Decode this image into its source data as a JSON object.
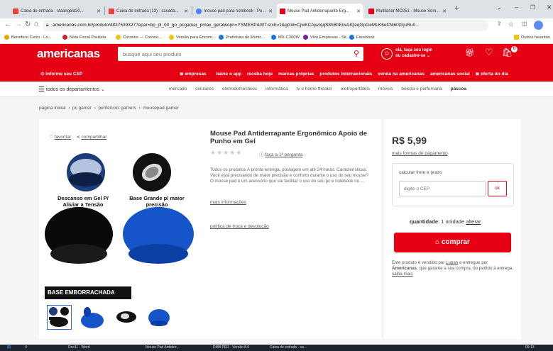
{
  "browser": {
    "tabs": [
      {
        "label": "Caixa de entrada - staangela20...",
        "color": "#ea4335"
      },
      {
        "label": "Caixa de entrada (13) - casada...",
        "color": "#ea4335"
      },
      {
        "label": "mouse pad para notebook - Pe...",
        "color": "#4285f4"
      },
      {
        "label": "Mouse Pad Antiderrapante Erg...",
        "color": "#e60014"
      },
      {
        "label": "Multilaser MO251 - Mouse Sem...",
        "color": "#e60014"
      }
    ],
    "new_tab": "+",
    "url": "americanas.com.br/produto/4837539327?epar=bp_pl_00_go_pcgamer_pmax_geral&opn=YSMESP&WT.srch=1&gclid=CjwKCAjwrqqS8hBhEiwAIQeqGpGeMLK6eCM6l3GjuRu0...",
    "bookmarks": [
      {
        "label": "Benefício Certo - Lo...",
        "color": "#f4a000"
      },
      {
        "label": "Nota Fiscal Paulista",
        "color": "#c62828"
      },
      {
        "label": "Correios — Correio...",
        "color": "#f4c20d"
      },
      {
        "label": "Versão para Encom...",
        "color": "#f4c20d"
      },
      {
        "label": "Prefeitura do Munic...",
        "color": "#1a73e8"
      },
      {
        "label": "MX-C300W",
        "color": "#1a73e8"
      },
      {
        "label": "Vivo Empresas - Sit...",
        "color": "#7b1fa2"
      },
      {
        "label": "Facebook",
        "color": "#1877f2"
      }
    ],
    "other_bookmarks": "Outros favoritos"
  },
  "header": {
    "logo": "americanas",
    "search_placeholder": "busque aqui seu produto",
    "login_line1": "olá, faça seu login",
    "login_line2": "ou cadastre-se",
    "cart_count": "0",
    "cep": "informe seu CEP",
    "links": [
      "empresas",
      "baixe o app",
      "receba hoje",
      "marcas próprias",
      "produtos internacionais",
      "venda na americanas",
      "americanas social",
      "oferta do dia"
    ]
  },
  "departments": {
    "menu_label": "todos os departamentos",
    "links": [
      "mercado",
      "celulares",
      "eletrodomésticos",
      "informática",
      "tv e home theater",
      "eletroportáteis",
      "móveis",
      "beleza e perfumaria",
      "páscoa"
    ]
  },
  "breadcrumb": [
    "página inicial",
    "pc gamer",
    "periféricos gamers",
    "mousepad gamer"
  ],
  "product": {
    "favorite": "favoritar",
    "share": "compartilhar",
    "title": "Mouse Pad Antiderrapante Ergonômico Apoio de Punho em Gel",
    "stars": "★★★★★",
    "question": "faça a 1ª pergunta",
    "description": "Todos os produtos A pronta entrega, postagem em até 24 horas. Características: Você está precisando de maior precisão e conforto durante o uso do seu mouse? O mouse pad é um acessório que vai facilitar o uso do seu pc e notebook no ...",
    "more_info": "mais informações",
    "policy": "política de troca e devolução",
    "image_caption_left": "Descanso em Gel P/ Aliviar a Tensão",
    "image_caption_right": "Base Grande p/ maior precisão",
    "image_banner": "BASE EMBORRACHADA"
  },
  "buy": {
    "price": "R$ 5,99",
    "payment_link": "mais formas de pagamento",
    "shipping_label": "calcular frete e prazo",
    "cep_placeholder": "digite o CEP",
    "ok": "ok",
    "quantity_label": "quantidade",
    "quantity_value": ": 1 unidade",
    "change": "alterar",
    "buy_button": "comprar",
    "seller_text_1": "Este produto é vendido por ",
    "seller_name": "Lupan",
    "seller_text_2": " e entregue por ",
    "seller_text_3": "Americanas",
    "seller_text_4": ", que garante a sua compra, do pedido à entrega.",
    "learn_more": "saiba mais"
  },
  "taskbar": {
    "items": [
      "Doc11 - Word",
      "Mouse Pad Antiderr...",
      "DMB PER - Versão 8.0",
      "Caixa de entrada - sa..."
    ],
    "time": "09:13"
  }
}
